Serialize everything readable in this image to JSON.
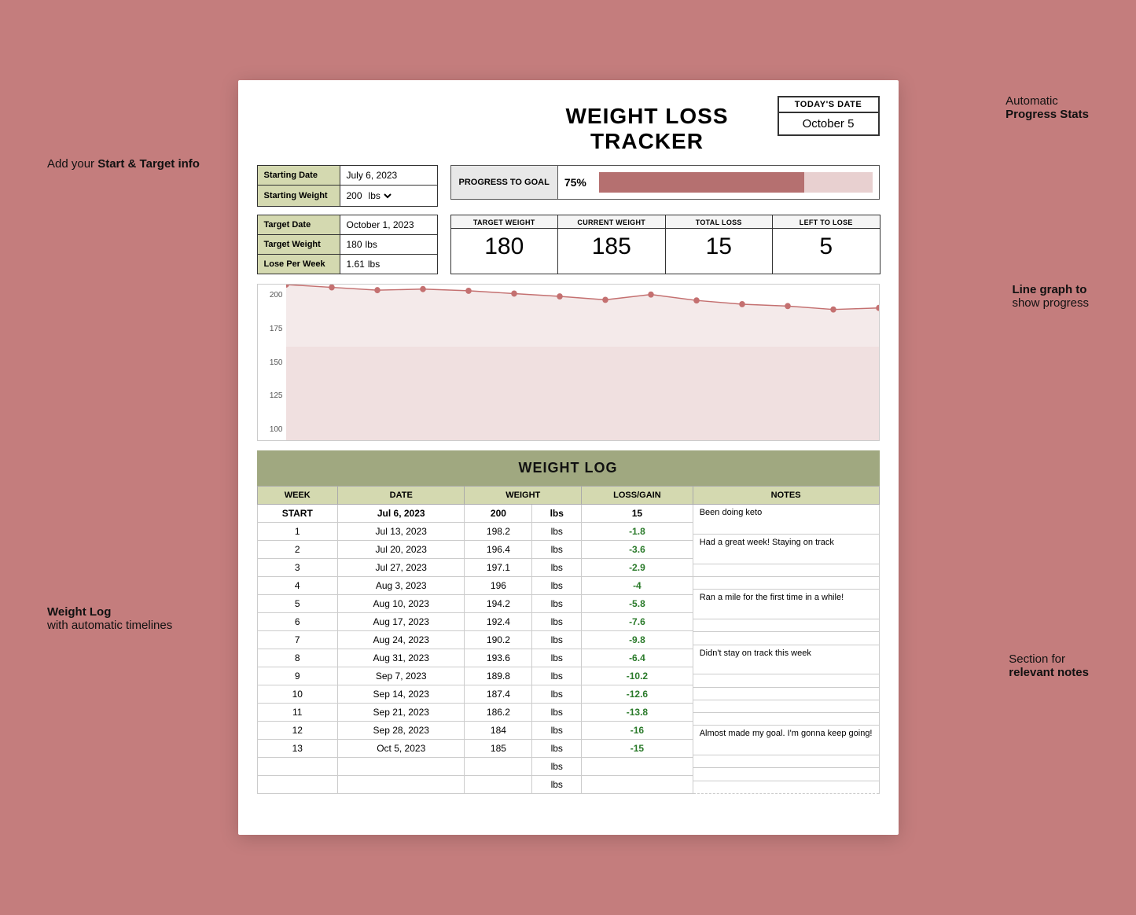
{
  "title": "WEIGHT LOSS TRACKER",
  "todaysDate": {
    "label": "TODAY'S DATE",
    "value": "October 5"
  },
  "startInfo": {
    "startingDate": {
      "label": "Starting Date",
      "value": "July 6, 2023"
    },
    "startingWeight": {
      "label": "Starting Weight",
      "value": "200",
      "unit": "lbs"
    }
  },
  "targetInfo": {
    "targetDate": {
      "label": "Target Date",
      "value": "October 1, 2023"
    },
    "targetWeight": {
      "label": "Target Weight",
      "value": "180",
      "unit": "lbs"
    },
    "losePerWeek": {
      "label": "Lose Per Week",
      "value": "1.61",
      "unit": "lbs"
    }
  },
  "progress": {
    "label": "PROGRESS TO GOAL",
    "percent": "75%",
    "barWidth": 75
  },
  "stats": [
    {
      "label": "TARGET WEIGHT",
      "value": "180"
    },
    {
      "label": "CURRENT WEIGHT",
      "value": "185"
    },
    {
      "label": "TOTAL LOSS",
      "value": "15"
    },
    {
      "label": "LEFT TO LOSE",
      "value": "5"
    }
  ],
  "chartYLabels": [
    "200",
    "175",
    "150",
    "125",
    "100"
  ],
  "weightLog": {
    "title": "WEIGHT LOG",
    "columns": [
      "WEEK",
      "DATE",
      "WEIGHT",
      "",
      "LOSS/GAIN"
    ],
    "rows": [
      {
        "week": "START",
        "date": "Jul 6, 2023",
        "weight": "200",
        "unit": "lbs",
        "lossGain": "15",
        "isStart": true
      },
      {
        "week": "1",
        "date": "Jul 13, 2023",
        "weight": "198.2",
        "unit": "lbs",
        "lossGain": "-1.8"
      },
      {
        "week": "2",
        "date": "Jul 20, 2023",
        "weight": "196.4",
        "unit": "lbs",
        "lossGain": "-3.6"
      },
      {
        "week": "3",
        "date": "Jul 27, 2023",
        "weight": "197.1",
        "unit": "lbs",
        "lossGain": "-2.9"
      },
      {
        "week": "4",
        "date": "Aug 3, 2023",
        "weight": "196",
        "unit": "lbs",
        "lossGain": "-4"
      },
      {
        "week": "5",
        "date": "Aug 10, 2023",
        "weight": "194.2",
        "unit": "lbs",
        "lossGain": "-5.8"
      },
      {
        "week": "6",
        "date": "Aug 17, 2023",
        "weight": "192.4",
        "unit": "lbs",
        "lossGain": "-7.6"
      },
      {
        "week": "7",
        "date": "Aug 24, 2023",
        "weight": "190.2",
        "unit": "lbs",
        "lossGain": "-9.8"
      },
      {
        "week": "8",
        "date": "Aug 31, 2023",
        "weight": "193.6",
        "unit": "lbs",
        "lossGain": "-6.4"
      },
      {
        "week": "9",
        "date": "Sep 7, 2023",
        "weight": "189.8",
        "unit": "lbs",
        "lossGain": "-10.2"
      },
      {
        "week": "10",
        "date": "Sep 14, 2023",
        "weight": "187.4",
        "unit": "lbs",
        "lossGain": "-12.6"
      },
      {
        "week": "11",
        "date": "Sep 21, 2023",
        "weight": "186.2",
        "unit": "lbs",
        "lossGain": "-13.8"
      },
      {
        "week": "12",
        "date": "Sep 28, 2023",
        "weight": "184",
        "unit": "lbs",
        "lossGain": "-16"
      },
      {
        "week": "13",
        "date": "Oct 5, 2023",
        "weight": "185",
        "unit": "lbs",
        "lossGain": "-15"
      },
      {
        "week": "",
        "date": "",
        "weight": "",
        "unit": "lbs",
        "lossGain": ""
      },
      {
        "week": "",
        "date": "",
        "weight": "",
        "unit": "lbs",
        "lossGain": ""
      }
    ],
    "notes": [
      "Been doing keto",
      "Had a great week! Staying on track",
      "",
      "",
      "Ran a mile for the first time in a while!",
      "",
      "",
      "Didn't stay on track this week",
      "",
      "",
      "",
      "",
      "Almost made my goal. I'm gonna keep going!",
      "",
      "",
      ""
    ]
  },
  "annotations": {
    "topRight": {
      "line1": "Automatic",
      "line2": "Progress Stats"
    },
    "leftTop": {
      "line1": "Add your",
      "line2": "Start & Target info"
    },
    "rightMid": {
      "line1": "Line graph to",
      "line2": "show progress"
    },
    "leftBottom": {
      "line1": "Weight Log",
      "line2": "with automatic timelines"
    },
    "rightBottom": {
      "line1": "Section for",
      "line2": "relevant notes"
    }
  }
}
